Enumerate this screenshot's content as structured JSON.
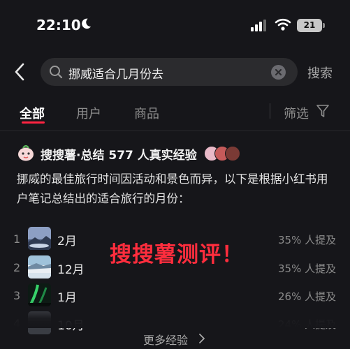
{
  "status_bar": {
    "time": "22:10",
    "battery": "21"
  },
  "search": {
    "query": "挪威适合几月份去",
    "search_button": "搜索"
  },
  "tabs": [
    {
      "label": "全部",
      "active": true
    },
    {
      "label": "用户",
      "active": false
    },
    {
      "label": "商品",
      "active": false
    }
  ],
  "filter": {
    "label": "筛选"
  },
  "card": {
    "title": "搜搜薯·总结 577 人真实经验",
    "summary": "挪威的最佳旅行时间因活动和景色而异，以下是根据小红书用户笔记总结出的适合旅行的月份：",
    "months": [
      {
        "rank": "1",
        "month": "2月",
        "mention": "35% 人提及"
      },
      {
        "rank": "2",
        "month": "12月",
        "mention": "35% 人提及"
      },
      {
        "rank": "3",
        "month": "1月",
        "mention": "26% 人提及"
      },
      {
        "rank": "4",
        "month": "10月",
        "mention": "24% 人提及"
      }
    ],
    "more_button": "更多经验"
  },
  "overlay": {
    "text": "搜搜薯测评！"
  },
  "colors": {
    "accent": "#ff2442",
    "overlay": "#ff2d3d",
    "background": "#16161a"
  },
  "icons": [
    "moon-icon",
    "signal-icon",
    "wifi-icon",
    "back-icon",
    "search-icon",
    "clear-icon",
    "filter-icon",
    "mascot-icon",
    "chevron-right-icon"
  ]
}
